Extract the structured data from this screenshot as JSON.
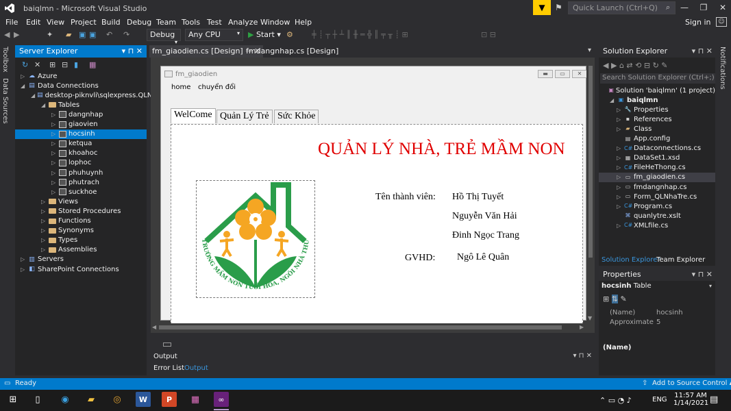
{
  "title_bar": {
    "app_title": "baiqlmn - Microsoft Visual Studio",
    "quick_launch_placeholder": "Quick Launch (Ctrl+Q)"
  },
  "menu": {
    "items": [
      "File",
      "Edit",
      "View",
      "Project",
      "Build",
      "Debug",
      "Team",
      "Tools",
      "Test",
      "Analyze",
      "Window",
      "Help"
    ],
    "sign_in": "Sign in"
  },
  "toolbar": {
    "config": "Debug",
    "platform": "Any CPU",
    "start": "Start"
  },
  "left_side_tabs": [
    "Toolbox",
    "Data Sources"
  ],
  "server_explorer": {
    "title": "Server Explorer",
    "tree": [
      {
        "label": "Azure",
        "level": 1,
        "icon": "azure-icon"
      },
      {
        "label": "Data Connections",
        "level": 1,
        "icon": "database-icon"
      },
      {
        "label": "desktop-piknvli\\sqlexpress.QLN",
        "level": 2,
        "icon": "database-icon"
      },
      {
        "label": "Tables",
        "level": 3,
        "icon": "folder-icon"
      },
      {
        "label": "dangnhap",
        "level": 4,
        "icon": "table-icon"
      },
      {
        "label": "giaovien",
        "level": 4,
        "icon": "table-icon"
      },
      {
        "label": "hocsinh",
        "level": 4,
        "icon": "table-icon",
        "selected": true
      },
      {
        "label": "ketqua",
        "level": 4,
        "icon": "table-icon"
      },
      {
        "label": "khoahoc",
        "level": 4,
        "icon": "table-icon"
      },
      {
        "label": "lophoc",
        "level": 4,
        "icon": "table-icon"
      },
      {
        "label": "phuhuynh",
        "level": 4,
        "icon": "table-icon"
      },
      {
        "label": "phutrach",
        "level": 4,
        "icon": "table-icon"
      },
      {
        "label": "suckhoe",
        "level": 4,
        "icon": "table-icon"
      },
      {
        "label": "Views",
        "level": 3,
        "icon": "folder-icon"
      },
      {
        "label": "Stored Procedures",
        "level": 3,
        "icon": "folder-icon"
      },
      {
        "label": "Functions",
        "level": 3,
        "icon": "folder-icon"
      },
      {
        "label": "Synonyms",
        "level": 3,
        "icon": "folder-icon"
      },
      {
        "label": "Types",
        "level": 3,
        "icon": "folder-icon"
      },
      {
        "label": "Assemblies",
        "level": 3,
        "icon": "folder-icon"
      },
      {
        "label": "Servers",
        "level": 1,
        "icon": "server-icon"
      },
      {
        "label": "SharePoint Connections",
        "level": 1,
        "icon": "sharepoint-icon"
      }
    ]
  },
  "doc_tabs": [
    "fm_giaodien.cs [Design]",
    "fmdangnhap.cs [Design]"
  ],
  "form": {
    "title": "fm_giaodien",
    "menu": [
      "home",
      "chuyển đổi"
    ],
    "tabs": [
      "WelCome",
      "Quản Lý Trẻ",
      "Sức Khỏe"
    ],
    "heading": "QUẢN LÝ NHÀ, TRẺ MẦM NON",
    "member_label": "Tên thành viên:",
    "members": [
      "Hồ Thị Tuyết",
      "Nguyễn Văn Hải",
      "Đinh Ngọc Trang"
    ],
    "advisor_label": "GVHD:",
    "advisor": "Ngô Lê Quân",
    "logo_text": "TRƯỜNG MẦM NON TUỔI HOA, NGÔI NHÀ THỨ HAI CỦA BÉ"
  },
  "output": {
    "title": "Output",
    "tabs": [
      "Error List",
      "Output"
    ]
  },
  "solution_explorer": {
    "title": "Solution Explorer",
    "search_placeholder": "Search Solution Explorer (Ctrl+;)",
    "items": [
      {
        "label": "Solution 'baiqlmn' (1 project)",
        "level": 0,
        "icon": "solution-icon"
      },
      {
        "label": "baiqlmn",
        "level": 1,
        "icon": "csharp-project-icon"
      },
      {
        "label": "Properties",
        "level": 2,
        "icon": "wrench-icon"
      },
      {
        "label": "References",
        "level": 2,
        "icon": "references-icon"
      },
      {
        "label": "Class",
        "level": 2,
        "icon": "folder-icon"
      },
      {
        "label": "App.config",
        "level": 2,
        "icon": "config-icon"
      },
      {
        "label": "Dataconnections.cs",
        "level": 2,
        "icon": "csharp-file-icon"
      },
      {
        "label": "DataSet1.xsd",
        "level": 2,
        "icon": "dataset-icon"
      },
      {
        "label": "FileHeThong.cs",
        "level": 2,
        "icon": "csharp-file-icon"
      },
      {
        "label": "fm_giaodien.cs",
        "level": 2,
        "icon": "form-icon",
        "selected": true
      },
      {
        "label": "fmdangnhap.cs",
        "level": 2,
        "icon": "form-icon"
      },
      {
        "label": "Form_QLNhaTre.cs",
        "level": 2,
        "icon": "form-icon"
      },
      {
        "label": "Program.cs",
        "level": 2,
        "icon": "csharp-file-icon"
      },
      {
        "label": "quanlytre.xslt",
        "level": 2,
        "icon": "xslt-icon"
      },
      {
        "label": "XMLfile.cs",
        "level": 2,
        "icon": "csharp-file-icon"
      }
    ],
    "bottom_tabs": [
      "Solution Explorer",
      "Team Explorer"
    ]
  },
  "properties": {
    "title": "Properties",
    "object_name": "hocsinh",
    "object_type": "Table",
    "rows": [
      {
        "name": "(Name)",
        "value": "hocsinh"
      },
      {
        "name": "Approximate Rc",
        "value": "5"
      }
    ],
    "description": "(Name)"
  },
  "right_side_tabs": [
    "Notifications"
  ],
  "status": {
    "text": "Ready",
    "source_control": "Add to Source Control"
  },
  "taskbar": {
    "time": "11:57 AM",
    "date": "1/14/2021",
    "language": "ENG"
  },
  "colors": {
    "accent": "#007acc",
    "title_red": "#e00000",
    "logo_green": "#2a9d4a",
    "logo_orange": "#f5a623"
  }
}
